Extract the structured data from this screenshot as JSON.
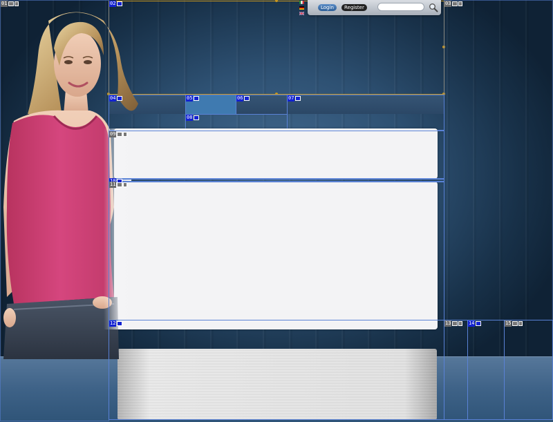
{
  "topbar": {
    "login_label": "Login",
    "register_label": "Register",
    "search_placeholder": "",
    "search_icon": "search-icon"
  },
  "language_flags": [
    "italy-flag-icon",
    "germany-flag-icon",
    "uk-flag-icon"
  ],
  "region_tags": [
    {
      "num": "01",
      "style": "gray"
    },
    {
      "num": "02",
      "style": "blue"
    },
    {
      "num": "03",
      "style": "gray"
    },
    {
      "num": "04",
      "style": "blue"
    },
    {
      "num": "05",
      "style": "blue"
    },
    {
      "num": "06",
      "style": "blue"
    },
    {
      "num": "07",
      "style": "blue"
    },
    {
      "num": "08",
      "style": "blue"
    },
    {
      "num": "09",
      "style": "gray"
    },
    {
      "num": "10",
      "style": "blue"
    },
    {
      "num": "11",
      "style": "gray"
    },
    {
      "num": "12",
      "style": "blue"
    },
    {
      "num": "13",
      "style": "gray"
    },
    {
      "num": "14",
      "style": "blue"
    },
    {
      "num": "15",
      "style": "gray"
    }
  ],
  "colors": {
    "tag_blue": "#1322d1",
    "outline_blue": "#5a82d6",
    "outline_orange": "#c8961e",
    "nav_active": "#3f7ab0",
    "background_wood": "#2e5173",
    "shirt_pink": "#d5467e"
  }
}
